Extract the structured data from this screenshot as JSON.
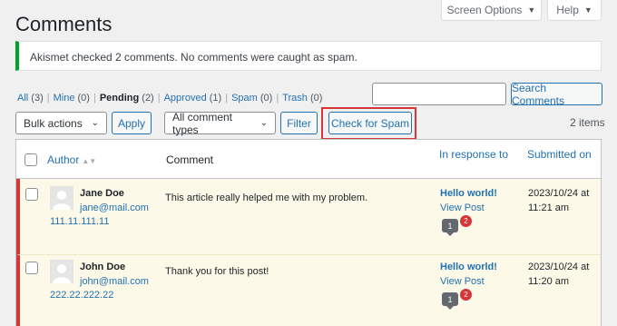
{
  "screen_meta": {
    "screen_options": "Screen Options",
    "help": "Help"
  },
  "page_title": "Comments",
  "notice": "Akismet checked 2 comments. No comments were caught as spam.",
  "filters": [
    {
      "label": "All",
      "count": "(3)"
    },
    {
      "label": "Mine",
      "count": "(0)"
    },
    {
      "label": "Pending",
      "count": "(2)",
      "current": true
    },
    {
      "label": "Approved",
      "count": "(1)"
    },
    {
      "label": "Spam",
      "count": "(0)"
    },
    {
      "label": "Trash",
      "count": "(0)"
    }
  ],
  "search": {
    "button": "Search Comments",
    "placeholder": ""
  },
  "toolbar": {
    "bulk_actions": "Bulk actions",
    "apply": "Apply",
    "comment_types": "All comment types",
    "filter": "Filter",
    "check_spam": "Check for Spam",
    "items_count": "2 items"
  },
  "columns": {
    "author": "Author",
    "comment": "Comment",
    "in_response_to": "In response to",
    "submitted_on": "Submitted on"
  },
  "rows": [
    {
      "name": "Jane Doe",
      "email": "jane@mail.com",
      "ip": "111.11.111.11",
      "comment": "This article really helped me with my problem.",
      "post_title": "Hello world!",
      "view_post": "View Post",
      "approved_count": "1",
      "pending_count": "2",
      "date": "2023/10/24 at",
      "time": "11:21 am"
    },
    {
      "name": "John Doe",
      "email": "john@mail.com",
      "ip": "222.22.222.22",
      "comment": "Thank you for this post!",
      "post_title": "Hello world!",
      "view_post": "View Post",
      "approved_count": "1",
      "pending_count": "2",
      "date": "2023/10/24 at",
      "time": "11:20 am"
    }
  ],
  "colors": {
    "accent": "#2271b1",
    "notice_border": "#00a32a",
    "pending_border": "#d63638",
    "pending_bg": "#fcf9e8",
    "highlight": "#d63638"
  }
}
